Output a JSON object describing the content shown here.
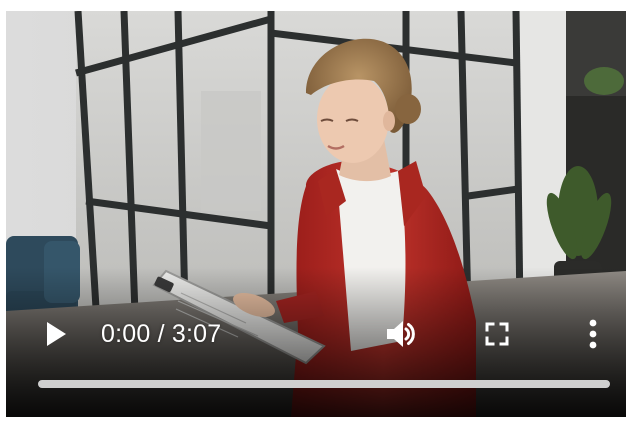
{
  "player": {
    "time_display": "0:00 / 3:07",
    "progress_fraction": 0.0,
    "icons": {
      "play": "play-icon",
      "volume": "volume-icon",
      "fullscreen": "fullscreen-icon",
      "more": "more-vertical-icon"
    },
    "colors": {
      "controls": "#ffffff",
      "jacket_accent": "#b3231f",
      "seek_track": "#cfcfcf"
    }
  }
}
